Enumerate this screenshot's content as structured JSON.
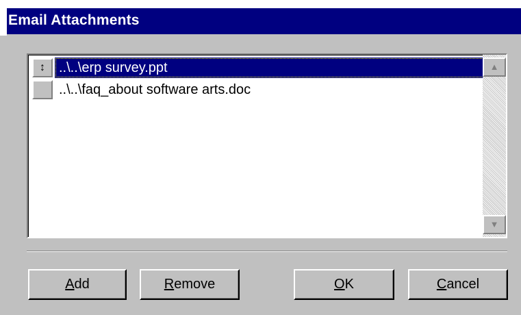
{
  "window": {
    "title": "Email Attachments"
  },
  "attachments": {
    "items": [
      {
        "handle_glyph": "↕",
        "path": "..\\..\\erp survey.ppt",
        "selected": true
      },
      {
        "handle_glyph": "",
        "path": "..\\..\\faq_about software arts.doc",
        "selected": false
      }
    ]
  },
  "scrollbar": {
    "up_glyph": "▲",
    "down_glyph": "▼"
  },
  "buttons": {
    "add": {
      "mnemonic": "A",
      "rest": "dd"
    },
    "remove": {
      "mnemonic": "R",
      "rest": "emove"
    },
    "ok": {
      "mnemonic": "O",
      "rest": "K"
    },
    "cancel": {
      "mnemonic": "C",
      "rest": "ancel"
    }
  },
  "colors": {
    "title_bar": "#000080",
    "dialog_bg": "#c0c0c0",
    "selection": "#000080",
    "list_bg": "#ffffff"
  }
}
